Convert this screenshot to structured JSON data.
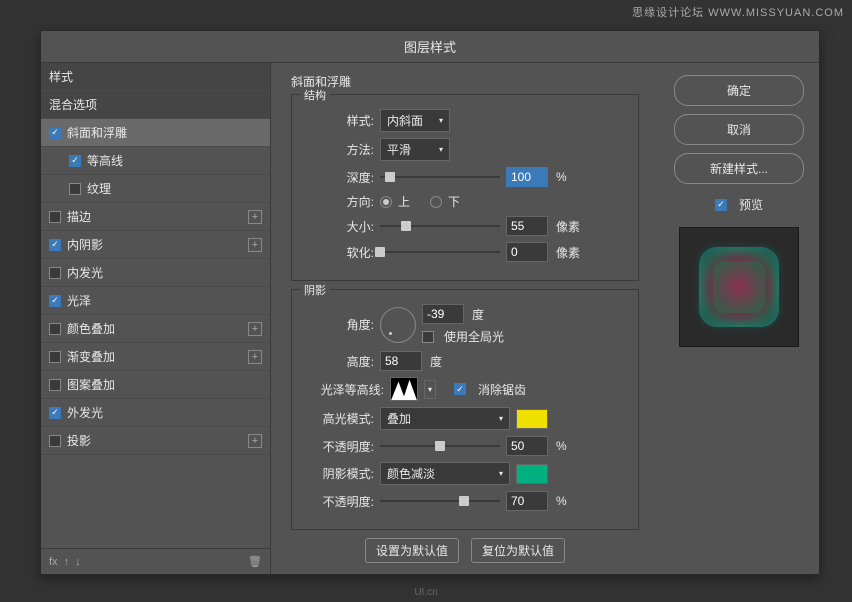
{
  "watermark": "思缘设计论坛  WWW.MISSYUAN.COM",
  "dialog_title": "图层样式",
  "sidebar": {
    "items": [
      {
        "label": "样式",
        "checked": null,
        "header": true
      },
      {
        "label": "混合选项",
        "checked": null,
        "header": true
      },
      {
        "label": "斜面和浮雕",
        "checked": true,
        "selected": true
      },
      {
        "label": "等高线",
        "checked": true,
        "indent": true
      },
      {
        "label": "纹理",
        "checked": false,
        "indent": true
      },
      {
        "label": "描边",
        "checked": false,
        "add": true
      },
      {
        "label": "内阴影",
        "checked": true,
        "add": true
      },
      {
        "label": "内发光",
        "checked": false
      },
      {
        "label": "光泽",
        "checked": true
      },
      {
        "label": "颜色叠加",
        "checked": false,
        "add": true
      },
      {
        "label": "渐变叠加",
        "checked": false,
        "add": true
      },
      {
        "label": "图案叠加",
        "checked": false
      },
      {
        "label": "外发光",
        "checked": true
      },
      {
        "label": "投影",
        "checked": false,
        "add": true
      }
    ],
    "fx": "fx"
  },
  "main": {
    "title": "斜面和浮雕",
    "structure": {
      "label": "结构",
      "style_label": "样式:",
      "style_value": "内斜面",
      "method_label": "方法:",
      "method_value": "平滑",
      "depth_label": "深度:",
      "depth_value": "100",
      "depth_unit": "%",
      "direction_label": "方向:",
      "dir_up": "上",
      "dir_down": "下",
      "size_label": "大小:",
      "size_value": "55",
      "size_unit": "像素",
      "soften_label": "软化:",
      "soften_value": "0",
      "soften_unit": "像素"
    },
    "shading": {
      "label": "阴影",
      "angle_label": "角度:",
      "angle_value": "-39",
      "angle_unit": "度",
      "global_light": "使用全局光",
      "altitude_label": "高度:",
      "altitude_value": "58",
      "altitude_unit": "度",
      "contour_label": "光泽等高线:",
      "antialias": "消除锯齿",
      "highlight_mode_label": "高光模式:",
      "highlight_mode_value": "叠加",
      "highlight_opacity_label": "不透明度:",
      "highlight_opacity_value": "50",
      "highlight_opacity_unit": "%",
      "shadow_mode_label": "阴影模式:",
      "shadow_mode_value": "颜色减淡",
      "shadow_opacity_label": "不透明度:",
      "shadow_opacity_value": "70",
      "shadow_opacity_unit": "%",
      "highlight_color": "#f0e000",
      "shadow_color": "#00b080"
    },
    "buttons": {
      "make_default": "设置为默认值",
      "reset_default": "复位为默认值"
    }
  },
  "right": {
    "ok": "确定",
    "cancel": "取消",
    "new_style": "新建样式...",
    "preview": "预览"
  },
  "footer_logo": "UI.cn"
}
